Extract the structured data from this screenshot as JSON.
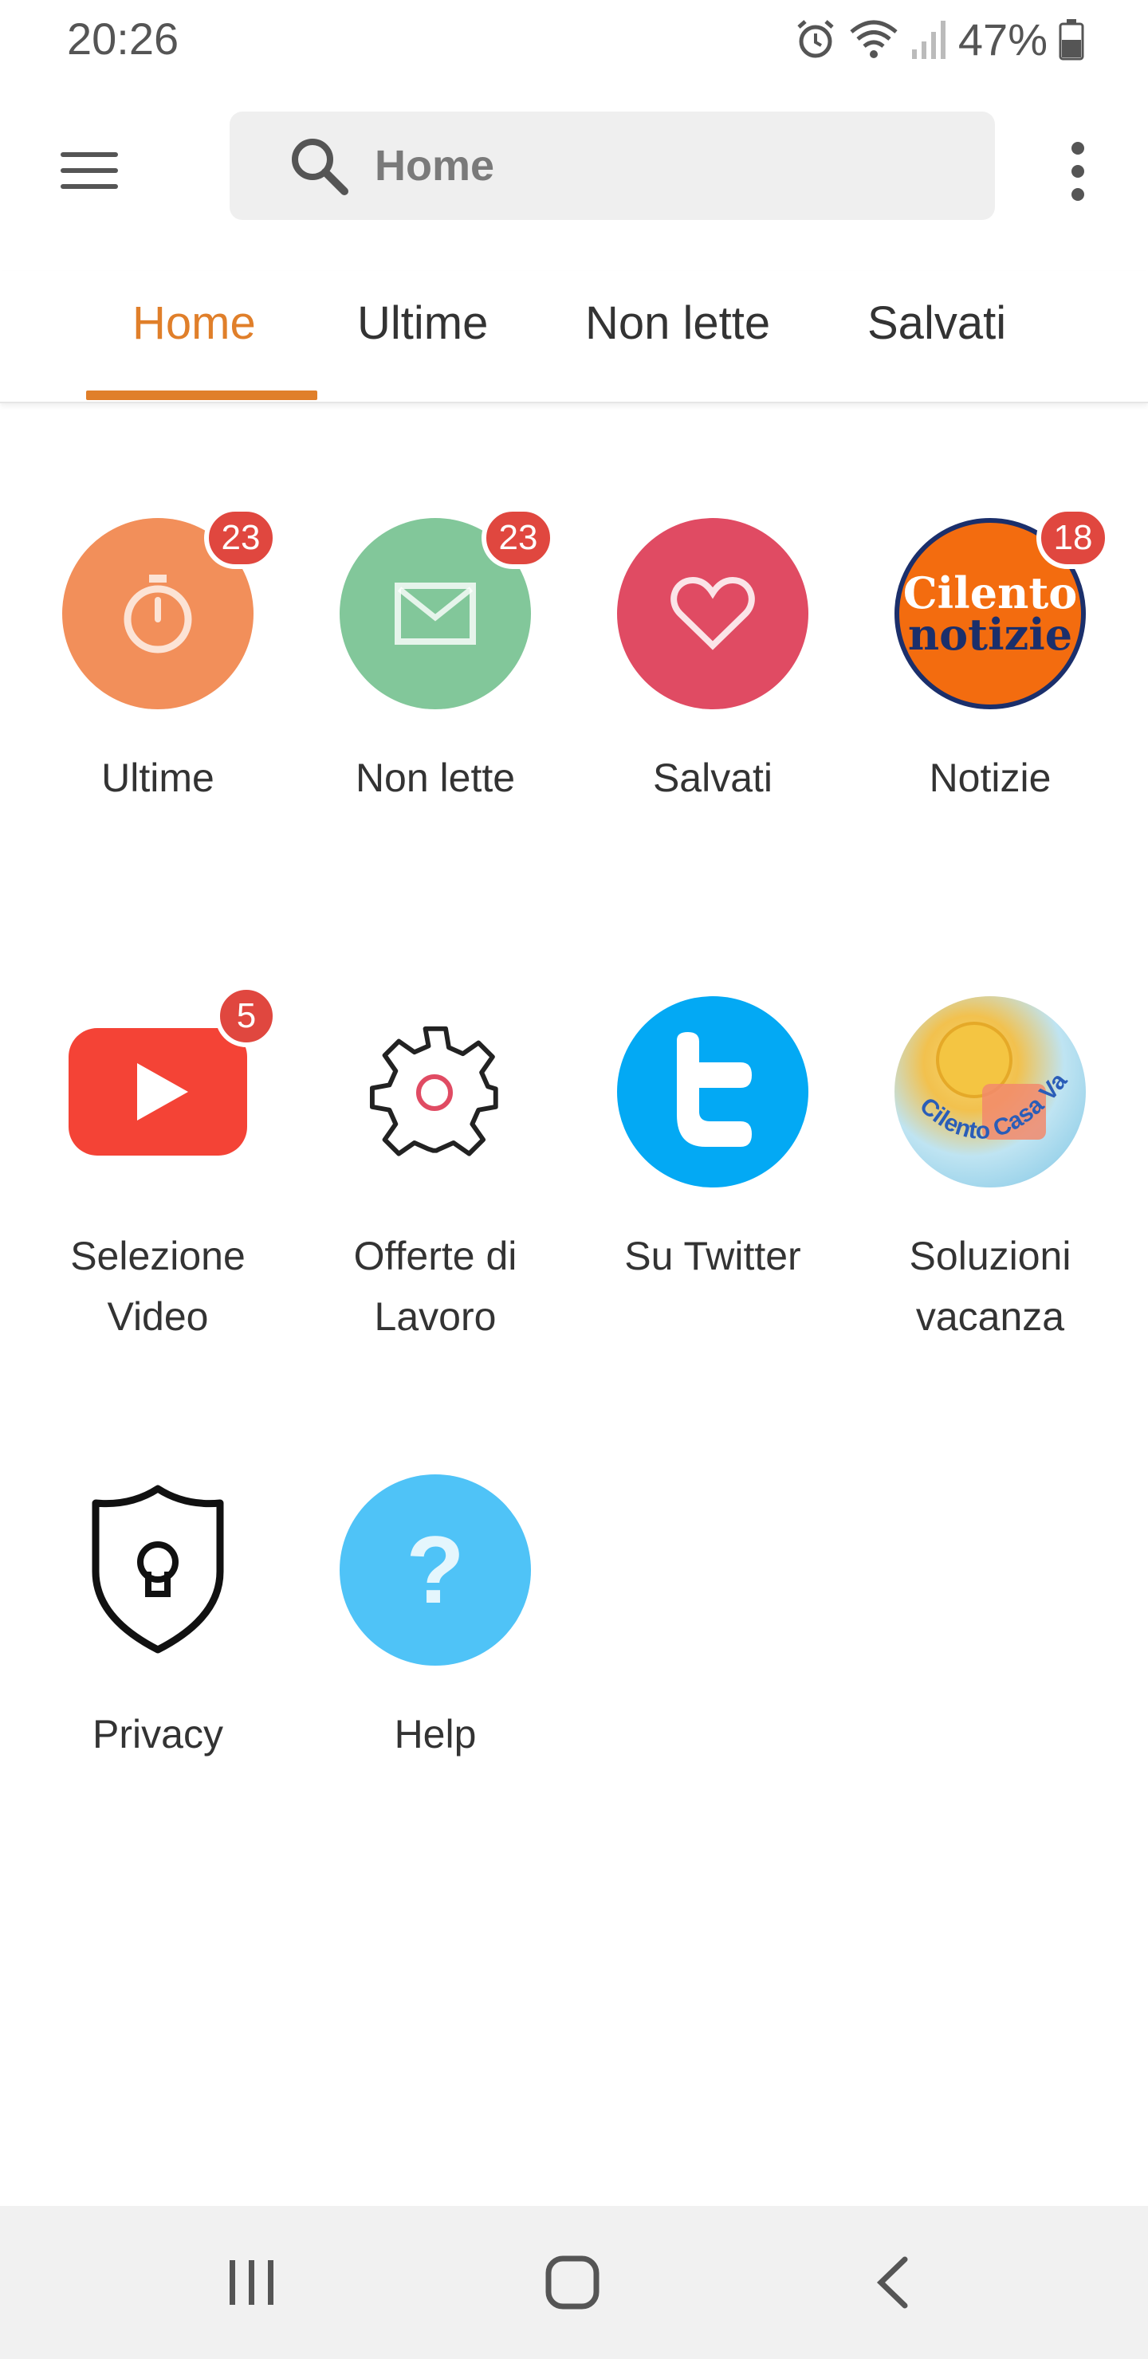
{
  "status_bar": {
    "time": "20:26",
    "battery": "47%",
    "icons": [
      "alarm-icon",
      "wifi-icon",
      "signal-icon",
      "battery-icon"
    ]
  },
  "app_bar": {
    "menu_icon": "hamburger-menu-icon",
    "search_placeholder": "Home",
    "more_icon": "more-vert-icon"
  },
  "tabs": [
    {
      "label": "Home",
      "active": true
    },
    {
      "label": "Ultime",
      "active": false
    },
    {
      "label": "Non lette",
      "active": false
    },
    {
      "label": "Salvati",
      "active": false
    }
  ],
  "accent_color": "#e07f2a",
  "tiles": [
    {
      "label": "Ultime",
      "icon": "stopwatch-icon",
      "color": "#f28f5a",
      "badge": "23"
    },
    {
      "label": "Non lette",
      "icon": "mail-icon",
      "color": "#82c79a",
      "badge": "23"
    },
    {
      "label": "Salvati",
      "icon": "heart-icon",
      "color": "#e04b63",
      "badge": ""
    },
    {
      "label": "Notizie",
      "icon": "cilento-notizie-logo",
      "logo_text_1": "Cilento",
      "logo_text_2": "notizie",
      "badge": "18"
    },
    {
      "label_line1": "Selezione",
      "label_line2": "Video",
      "icon": "youtube-icon",
      "color": "#f44336",
      "badge": "5"
    },
    {
      "label_line1": "Offerte di",
      "label_line2": "Lavoro",
      "icon": "gear-icon",
      "badge": ""
    },
    {
      "label": "Su Twitter",
      "icon": "twitter-icon",
      "color": "#03a9f4",
      "badge": ""
    },
    {
      "label_line1": "Soluzioni",
      "label_line2": "vacanza",
      "icon": "cilento-casa-vacanze-logo",
      "logo_text": "Cilento Casa Vacanze",
      "badge": ""
    },
    {
      "label": "Privacy",
      "icon": "shield-lock-icon",
      "badge": ""
    },
    {
      "label": "Help",
      "icon": "question-icon",
      "color": "#4fc3f7",
      "badge": ""
    }
  ],
  "nav_bar": {
    "icons": [
      "recent-apps-icon",
      "home-icon",
      "back-icon"
    ]
  }
}
